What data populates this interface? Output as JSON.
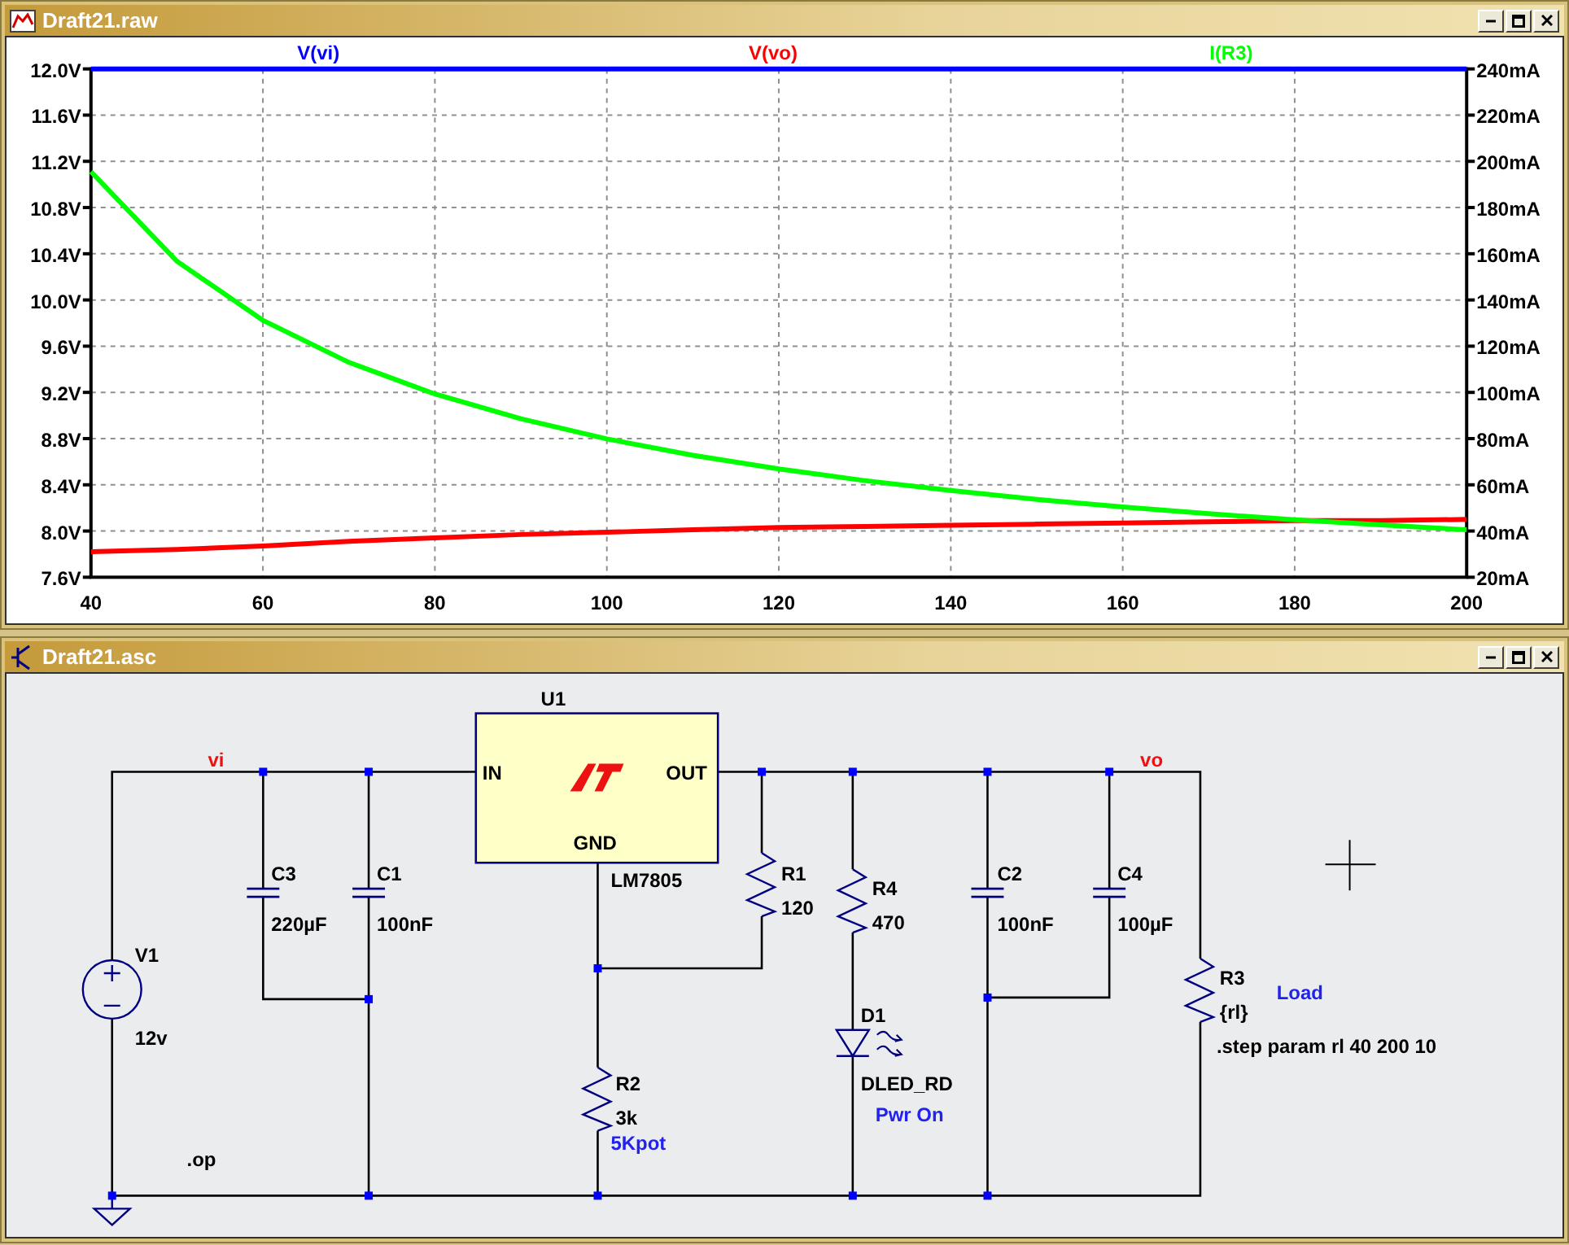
{
  "plot_window": {
    "title": "Draft21.raw",
    "chart_data": {
      "type": "line",
      "x": [
        40,
        50,
        60,
        70,
        80,
        90,
        100,
        110,
        120,
        130,
        140,
        150,
        160,
        170,
        180,
        190,
        200
      ],
      "series": [
        {
          "name": "V(vi)",
          "color": "#0000ff",
          "values": [
            12.0,
            12.0,
            12.0,
            12.0,
            12.0,
            12.0,
            12.0,
            12.0,
            12.0,
            12.0,
            12.0,
            12.0,
            12.0,
            12.0,
            12.0,
            12.0,
            12.0
          ]
        },
        {
          "name": "V(vo)",
          "color": "#ff0000",
          "values": [
            7.82,
            7.84,
            7.87,
            7.91,
            7.94,
            7.97,
            7.99,
            8.01,
            8.03,
            8.04,
            8.05,
            8.06,
            8.07,
            8.08,
            8.09,
            8.09,
            8.1
          ]
        },
        {
          "name": "I(R3)",
          "color": "#00ff00",
          "axis": "y2",
          "values": [
            195.5,
            156.8,
            131.2,
            113.0,
            99.3,
            88.6,
            79.9,
            72.8,
            66.9,
            61.8,
            57.5,
            53.7,
            50.4,
            47.5,
            44.9,
            42.6,
            40.5
          ]
        }
      ],
      "grid": true,
      "xlim": [
        40,
        200
      ],
      "ylim": [
        7.6,
        12.0
      ],
      "y2lim": [
        20,
        240
      ],
      "xticks": [
        40,
        60,
        80,
        100,
        120,
        140,
        160,
        180,
        200
      ],
      "yticks": [
        {
          "value": 12.0,
          "label": "12.0V"
        },
        {
          "value": 11.6,
          "label": "11.6V"
        },
        {
          "value": 11.2,
          "label": "11.2V"
        },
        {
          "value": 10.8,
          "label": "10.8V"
        },
        {
          "value": 10.4,
          "label": "10.4V"
        },
        {
          "value": 10.0,
          "label": "10.0V"
        },
        {
          "value": 9.6,
          "label": "9.6V"
        },
        {
          "value": 9.2,
          "label": "9.2V"
        },
        {
          "value": 8.8,
          "label": "8.8V"
        },
        {
          "value": 8.4,
          "label": "8.4V"
        },
        {
          "value": 8.0,
          "label": "8.0V"
        },
        {
          "value": 7.6,
          "label": "7.6V"
        }
      ],
      "y2ticks": [
        {
          "value": 240,
          "label": "240mA"
        },
        {
          "value": 220,
          "label": "220mA"
        },
        {
          "value": 200,
          "label": "200mA"
        },
        {
          "value": 180,
          "label": "180mA"
        },
        {
          "value": 160,
          "label": "160mA"
        },
        {
          "value": 140,
          "label": "140mA"
        },
        {
          "value": 120,
          "label": "120mA"
        },
        {
          "value": 100,
          "label": "100mA"
        },
        {
          "value": 80,
          "label": "80mA"
        },
        {
          "value": 60,
          "label": "60mA"
        },
        {
          "value": 40,
          "label": "40mA"
        },
        {
          "value": 20,
          "label": "20mA"
        }
      ]
    }
  },
  "schematic_window": {
    "title": "Draft21.asc",
    "components": [
      {
        "kind": "source",
        "name": "V1",
        "value": "12v"
      },
      {
        "kind": "capacitor",
        "name": "C3",
        "value": "220µF"
      },
      {
        "kind": "capacitor",
        "name": "C1",
        "value": "100nF"
      },
      {
        "kind": "regulator",
        "name": "U1",
        "value": "LM7805",
        "pins": [
          "IN",
          "OUT",
          "GND"
        ]
      },
      {
        "kind": "resistor",
        "name": "R1",
        "value": "120"
      },
      {
        "kind": "resistor",
        "name": "R2",
        "value": "3k",
        "note": "5Kpot"
      },
      {
        "kind": "resistor",
        "name": "R4",
        "value": "470"
      },
      {
        "kind": "led",
        "name": "D1",
        "value": "DLED_RD",
        "note": "Pwr On"
      },
      {
        "kind": "capacitor",
        "name": "C2",
        "value": "100nF"
      },
      {
        "kind": "capacitor",
        "name": "C4",
        "value": "100µF"
      },
      {
        "kind": "resistor",
        "name": "R3",
        "value": "{rl}",
        "note": "Load"
      }
    ],
    "net_labels": [
      "vi",
      "vo"
    ],
    "directives": [
      ".op",
      ".step param rl 40 200 10"
    ]
  }
}
